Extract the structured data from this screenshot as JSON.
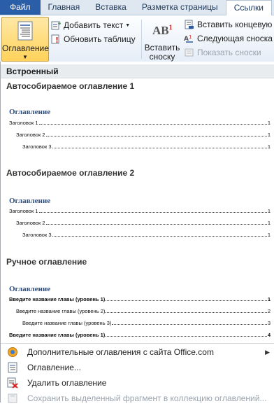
{
  "tabs": [
    "Файл",
    "Главная",
    "Вставка",
    "Разметка страницы",
    "Ссылки"
  ],
  "ribbon": {
    "toc_button": "Оглавление",
    "add_text": "Добавить текст",
    "update_table": "Обновить таблицу",
    "insert_footnote_line1": "Вставить",
    "insert_footnote_line2": "сноску",
    "footnote_icon_text": "AB",
    "footnote_icon_sup": "1",
    "insert_endnote": "Вставить концевую с",
    "next_footnote": "Следующая сноска",
    "show_notes": "Показать сноски"
  },
  "gallery": {
    "section_header": "Встроенный",
    "items": [
      {
        "title": "Автособираемое оглавление 1",
        "toc_heading": "Оглавление",
        "lines": [
          {
            "text": "Заголовок 1",
            "page": "1"
          },
          {
            "text": "Заголовок 2",
            "page": "1"
          },
          {
            "text": "Заголовок 3",
            "page": "1"
          }
        ]
      },
      {
        "title": "Автособираемое оглавление 2",
        "toc_heading": "Оглавление",
        "lines": [
          {
            "text": "Заголовок 1",
            "page": "1"
          },
          {
            "text": "Заголовок 2",
            "page": "1"
          },
          {
            "text": "Заголовок 3",
            "page": "1"
          }
        ]
      },
      {
        "title": "Ручное оглавление",
        "toc_heading": "Оглавление",
        "lines": [
          {
            "text": "Введите название главы (уровень 1)",
            "page": "1"
          },
          {
            "text": "Введите название главы (уровень 2)",
            "page": "2"
          },
          {
            "text": "Введите название главы (уровень 3)",
            "page": "3"
          },
          {
            "text": "Введите название главы (уровень 1)",
            "page": "4"
          }
        ]
      }
    ]
  },
  "menu": {
    "more_tocs": "Дополнительные оглавления с сайта Office.com",
    "toc_dialog": "Оглавление...",
    "remove_toc": "Удалить оглавление",
    "save_selection": "Сохранить выделенный фрагмент в коллекцию оглавлений..."
  },
  "colors": {
    "file_tab": "#2a5ea8",
    "toc_heading": "#2e4d7b",
    "pressed_button": "#ffd25a"
  }
}
